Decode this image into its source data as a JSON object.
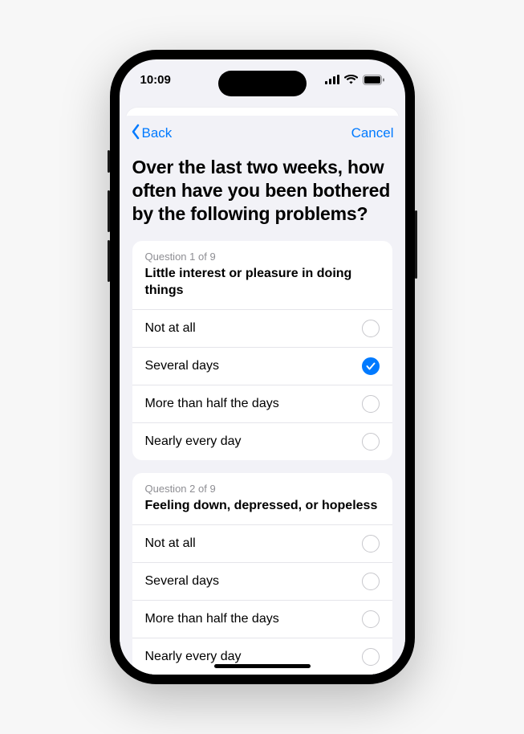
{
  "status": {
    "time": "10:09"
  },
  "nav": {
    "back": "Back",
    "cancel": "Cancel"
  },
  "prompt": "Over the last two weeks, how often have you been bothered by the following problems?",
  "questions": [
    {
      "counter": "Question 1 of 9",
      "text": "Little interest or pleasure in doing things",
      "options": [
        {
          "label": "Not at all",
          "selected": false
        },
        {
          "label": "Several days",
          "selected": true
        },
        {
          "label": "More than half the days",
          "selected": false
        },
        {
          "label": "Nearly every day",
          "selected": false
        }
      ]
    },
    {
      "counter": "Question 2 of 9",
      "text": "Feeling down, depressed, or hopeless",
      "options": [
        {
          "label": "Not at all",
          "selected": false
        },
        {
          "label": "Several days",
          "selected": false
        },
        {
          "label": "More than half the days",
          "selected": false
        },
        {
          "label": "Nearly every day",
          "selected": false
        }
      ]
    }
  ]
}
